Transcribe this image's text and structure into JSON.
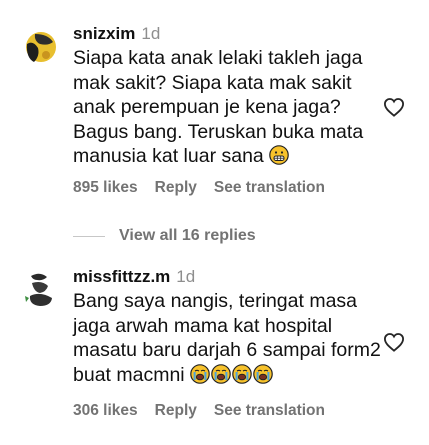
{
  "comments": [
    {
      "username": "snizxim",
      "time": "1d",
      "lines": [
        "Siapa kata anak lelaki takleh jaga",
        "mak sakit? Siapa kata mak sakit",
        "anak perempuan je kena jaga?",
        "Bagus bang. Teruskan buka mata",
        "manusia kat luar sana"
      ],
      "emoji": "grimacing-face",
      "likes": "895 likes",
      "reply": "Reply",
      "see_translation": "See translation"
    },
    {
      "username": "missfittzz.m",
      "time": "1d",
      "lines": [
        "Bang saya nangis, teringat masa",
        "jaga arwah mama kat hospital",
        "masatu baru darjah 6 sampai form2",
        "buat macmni"
      ],
      "emoji": "loudly-crying-face",
      "emoji_count": 4,
      "likes": "306 likes",
      "reply": "Reply",
      "see_translation": "See translation"
    }
  ],
  "view_replies": "View all 16 replies",
  "colors": {
    "text": "#111111",
    "secondary": "#8e8e8e",
    "action": "#737373",
    "divider": "#c7c7c7",
    "emoji_yellow": "#f7c22b"
  },
  "icons": [
    "heart-outline-icon",
    "grimacing-face-emoji",
    "loudly-crying-face-emoji"
  ]
}
